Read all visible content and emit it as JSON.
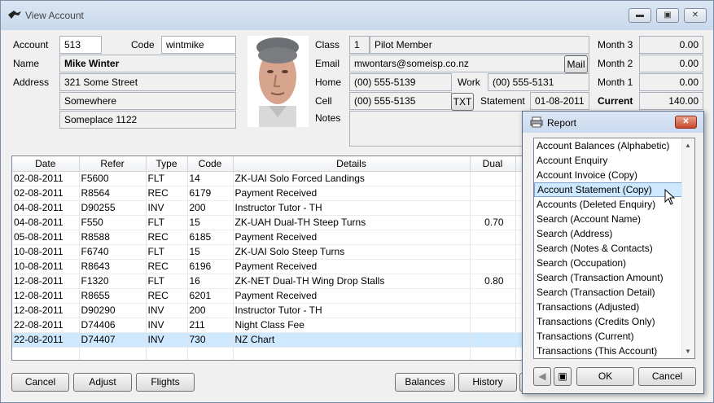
{
  "window": {
    "title": "View Account",
    "controls": [
      "minimize",
      "maximize",
      "close"
    ]
  },
  "account": {
    "account_label": "Account",
    "account_value": "513",
    "code_label": "Code",
    "code_value": "wintmike",
    "name_label": "Name",
    "name_value": "Mike Winter",
    "address_label": "Address",
    "address_line1": "321 Some Street",
    "address_line2": "Somewhere",
    "address_line3": "Someplace 1122"
  },
  "contact": {
    "class_label": "Class",
    "class_num": "1",
    "class_name": "Pilot Member",
    "email_label": "Email",
    "email_value": "mwontars@someisp.co.nz",
    "mail_button": "Mail",
    "home_label": "Home",
    "home_value": "(00) 555-5139",
    "work_label": "Work",
    "work_value": "(00) 555-5131",
    "cell_label": "Cell",
    "cell_value": "(00) 555-5135",
    "txt_button": "TXT",
    "statement_label": "Statement",
    "statement_value": "01-08-2011",
    "notes_label": "Notes"
  },
  "balances": {
    "month3_label": "Month 3",
    "month3_value": "0.00",
    "month2_label": "Month 2",
    "month2_value": "0.00",
    "month1_label": "Month 1",
    "month1_value": "0.00",
    "current_label": "Current",
    "current_value": "140.00"
  },
  "grid": {
    "headers": [
      "Date",
      "Refer",
      "Type",
      "Code",
      "Details",
      "Dual"
    ],
    "rows": [
      [
        "02-08-2011",
        "F5600",
        "FLT",
        "14",
        "ZK-UAI Solo  Forced Landings",
        ""
      ],
      [
        "02-08-2011",
        "R8564",
        "REC",
        "6179",
        "Payment Received",
        ""
      ],
      [
        "04-08-2011",
        "D90255",
        "INV",
        "200",
        "Instructor Tutor - TH",
        ""
      ],
      [
        "04-08-2011",
        "F550",
        "FLT",
        "15",
        "ZK-UAH Dual-TH  Steep Turns",
        "0.70"
      ],
      [
        "05-08-2011",
        "R8588",
        "REC",
        "6185",
        "Payment Received",
        ""
      ],
      [
        "10-08-2011",
        "F6740",
        "FLT",
        "15",
        "ZK-UAI Solo  Steep Turns",
        ""
      ],
      [
        "10-08-2011",
        "R8643",
        "REC",
        "6196",
        "Payment Received",
        ""
      ],
      [
        "12-08-2011",
        "F1320",
        "FLT",
        "16",
        "ZK-NET Dual-TH  Wing Drop Stalls",
        "0.80"
      ],
      [
        "12-08-2011",
        "R8655",
        "REC",
        "6201",
        "Payment Received",
        ""
      ],
      [
        "12-08-2011",
        "D90290",
        "INV",
        "200",
        "Instructor Tutor - TH",
        ""
      ],
      [
        "22-08-2011",
        "D74406",
        "INV",
        "211",
        "Night Class Fee",
        ""
      ],
      [
        "22-08-2011",
        "D74407",
        "INV",
        "730",
        "NZ Chart",
        ""
      ]
    ]
  },
  "buttons": {
    "cancel": "Cancel",
    "adjust": "Adjust",
    "flights": "Flights",
    "balances": "Balances",
    "history": "History"
  },
  "report_dialog": {
    "title": "Report",
    "items": [
      "Account Balances (Alphabetic)",
      "Account Enquiry",
      "Account Invoice (Copy)",
      "Account Statement (Copy)",
      "Accounts (Deleted Enquiry)",
      "Search (Account Name)",
      "Search (Address)",
      "Search (Notes & Contacts)",
      "Search (Occupation)",
      "Search (Transaction Amount)",
      "Search (Transaction Detail)",
      "Transactions (Adjusted)",
      "Transactions (Credits Only)",
      "Transactions (Current)",
      "Transactions (This Account)"
    ],
    "selected_index": 3,
    "ok": "OK",
    "cancel": "Cancel"
  }
}
